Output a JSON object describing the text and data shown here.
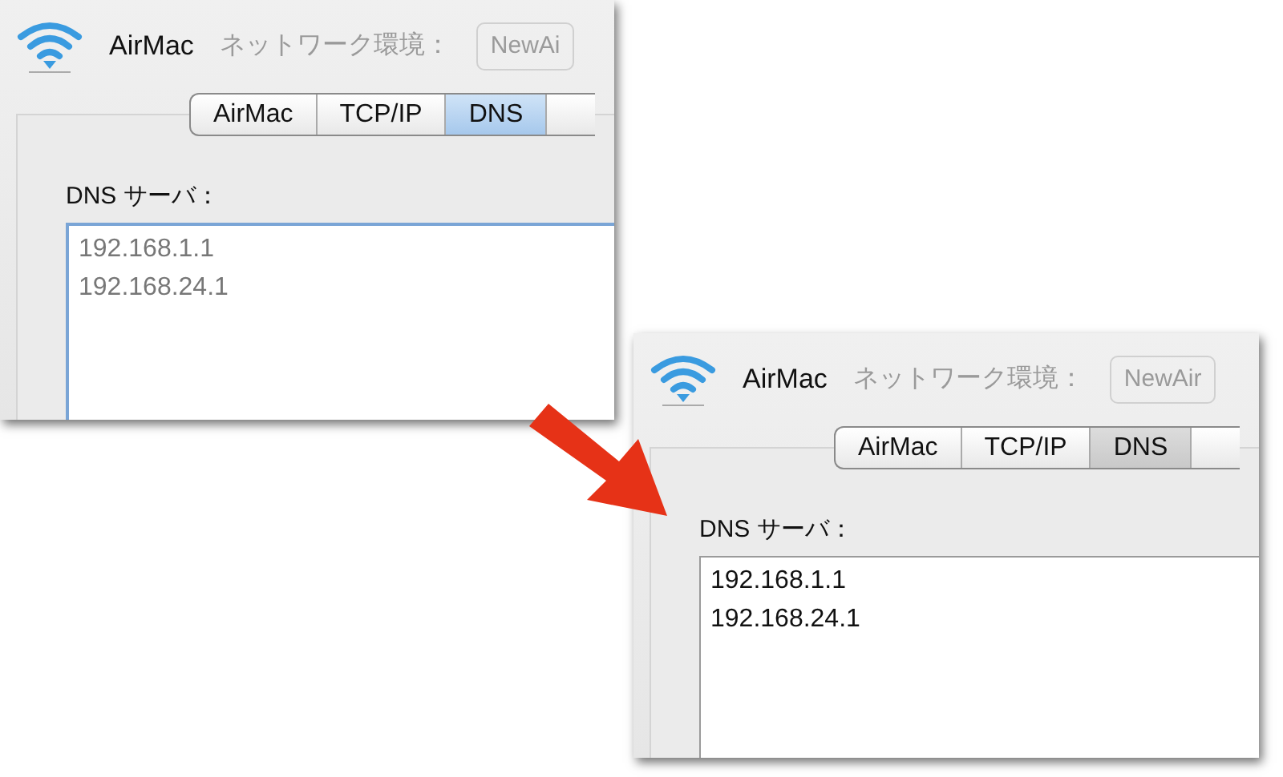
{
  "panels": [
    {
      "title": "AirMac",
      "location_label": "ネットワーク環境：",
      "location_value": "NewAi",
      "focused": true,
      "tabs": [
        {
          "label": "AirMac",
          "selected": false
        },
        {
          "label": "TCP/IP",
          "selected": false
        },
        {
          "label": "DNS",
          "selected": true
        }
      ],
      "dns_label": "DNS サーバ：",
      "dns_servers": [
        "192.168.1.1",
        "192.168.24.1"
      ]
    },
    {
      "title": "AirMac",
      "location_label": "ネットワーク環境：",
      "location_value": "NewAir",
      "focused": false,
      "tabs": [
        {
          "label": "AirMac",
          "selected": false
        },
        {
          "label": "TCP/IP",
          "selected": false
        },
        {
          "label": "DNS",
          "selected": true
        }
      ],
      "dns_label": "DNS サーバ：",
      "dns_servers": [
        "192.168.1.1",
        "192.168.24.1"
      ]
    }
  ]
}
